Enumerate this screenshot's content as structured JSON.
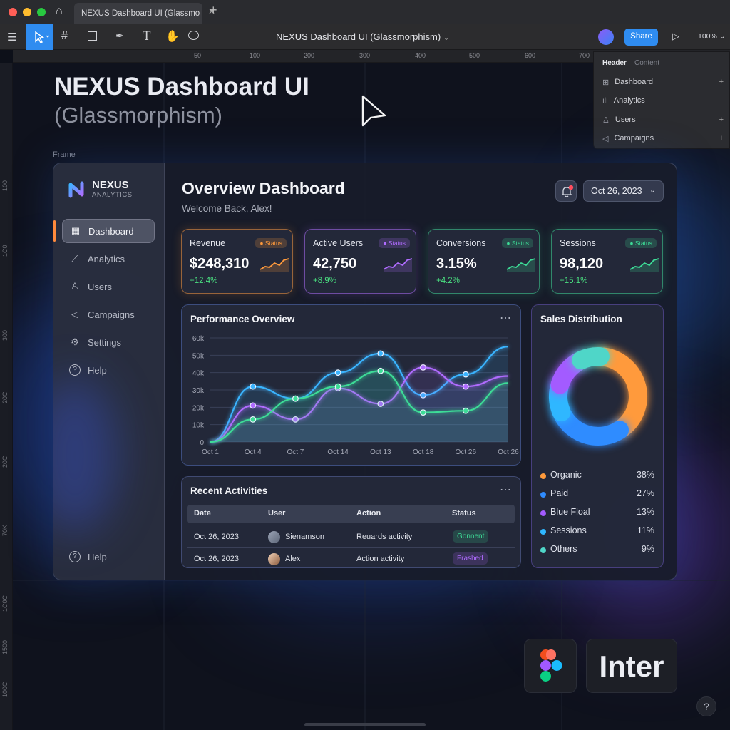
{
  "browser": {
    "tab_title": "NEXUS Dashboard UI (Glassmo",
    "close_glyph": "✕",
    "new_tab_glyph": "+"
  },
  "toolbar": {
    "doc_title": "NEXUS Dashboard UI (Glassmorphism)",
    "share_label": "Share",
    "zoom": "100%"
  },
  "ruler": {
    "top_ticks": [
      "50",
      "100",
      "200",
      "300",
      "400",
      "500",
      "600",
      "700"
    ],
    "left_ticks": [
      "100",
      "1C0",
      "300",
      "20C",
      "20C",
      "70K",
      "1C0C",
      "1500",
      "100C"
    ]
  },
  "layers_panel": {
    "tabs": [
      "Header",
      "Content"
    ],
    "items": [
      {
        "label": "Dashboard",
        "icon": "grid-icon",
        "has_add": true
      },
      {
        "label": "Analytics",
        "icon": "bar-chart-icon",
        "has_add": false
      },
      {
        "label": "Users",
        "icon": "users-icon",
        "has_add": true
      },
      {
        "label": "Campaigns",
        "icon": "megaphone-icon",
        "has_add": true
      }
    ]
  },
  "canvas": {
    "heading": "NEXUS Dashboard UI",
    "subheading": "(Glassmorphism)",
    "frame_label": "Frame",
    "font_label": "Inter"
  },
  "dashboard": {
    "brand": "NEXUS",
    "brand_sub": "ANALYTICS",
    "nav": [
      {
        "label": "Dashboard",
        "icon": "grid-icon",
        "active": true
      },
      {
        "label": "Analytics",
        "icon": "line-chart-icon",
        "active": false
      },
      {
        "label": "Users",
        "icon": "users-icon",
        "active": false
      },
      {
        "label": "Campaigns",
        "icon": "megaphone-icon",
        "active": false
      },
      {
        "label": "Settings",
        "icon": "gear-icon",
        "active": false
      },
      {
        "label": "Help",
        "icon": "question-icon",
        "active": false
      }
    ],
    "bottom_help": "Help",
    "title": "Overview Dashboard",
    "welcome": "Welcome Back, Alex!",
    "date": "Oct 26, 2023",
    "stats": [
      {
        "label": "Revenue",
        "value": "$248,310",
        "change": "+12.4%",
        "badge": "Status",
        "color": "#ff9a3c",
        "change_color": "#4ade80"
      },
      {
        "label": "Active Users",
        "value": "42,750",
        "change": "+8.9%",
        "badge": "Status",
        "color": "#b06cff",
        "change_color": "#4ade80"
      },
      {
        "label": "Conversions",
        "value": "3.15%",
        "change": "+4.2%",
        "badge": "Status",
        "color": "#3ddc97",
        "change_color": "#4ade80"
      },
      {
        "label": "Sessions",
        "value": "98,120",
        "change": "+15.1%",
        "badge": "Status",
        "color": "#3ddc97",
        "change_color": "#4ade80"
      }
    ],
    "activities": {
      "title": "Recent Activities",
      "columns": [
        "Date",
        "User",
        "Action",
        "Status"
      ],
      "rows": [
        {
          "date": "Oct 26, 2023",
          "user": "Sienamson",
          "action": "Reuards activity",
          "status": "Gonnent",
          "status_color": "#3ddc97"
        },
        {
          "date": "Oct 26, 2023",
          "user": "Alex",
          "action": "Action activity",
          "status": "Frashed",
          "status_color": "#b06cff"
        }
      ]
    }
  },
  "chart_data": [
    {
      "type": "line",
      "title": "Performance Overview",
      "categories": [
        "Oct 1",
        "Oct 4",
        "Oct 7",
        "Oct 14",
        "Oct 13",
        "Oct 18",
        "Oct 26",
        "Oct 26"
      ],
      "yticks": [
        "0",
        "10k",
        "20k",
        "30k",
        "40k",
        "50k",
        "60k"
      ],
      "ylim": [
        0,
        60000
      ],
      "series": [
        {
          "color": "#3ab4ff",
          "values": [
            0,
            32000,
            25000,
            40000,
            51000,
            27000,
            39000,
            55000
          ]
        },
        {
          "color": "#b06cff",
          "values": [
            0,
            21000,
            13000,
            31000,
            22000,
            43000,
            32000,
            38000
          ]
        },
        {
          "color": "#3ddc97",
          "values": [
            0,
            13000,
            25000,
            32000,
            41000,
            17000,
            18000,
            34000
          ]
        }
      ]
    },
    {
      "type": "pie",
      "title": "Sales Distribution",
      "labels": [
        "Organic",
        "Paid",
        "Blue Floal",
        "Sessions",
        "Others"
      ],
      "values": [
        38,
        27,
        13,
        11,
        9
      ],
      "display": [
        "38%",
        "27%",
        "13%",
        "11%",
        "9%"
      ],
      "colors": [
        "#ff9a3c",
        "#2f8cff",
        "#a35bff",
        "#2fb7ff",
        "#4fd6c8"
      ]
    }
  ]
}
